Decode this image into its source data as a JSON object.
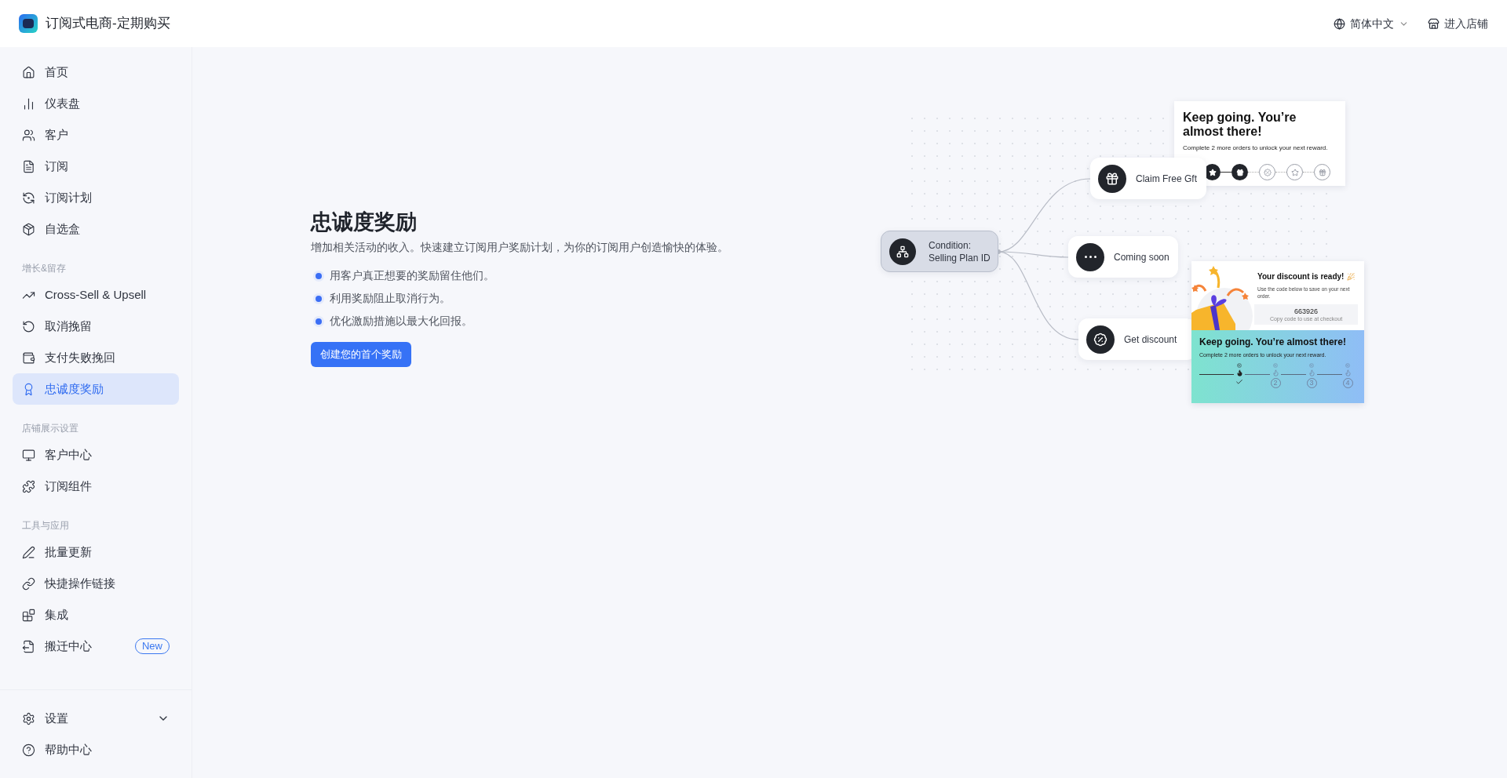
{
  "header": {
    "app_title": "订阅式电商-定期购买",
    "language": "简体中文",
    "store_link": "进入店铺"
  },
  "sidebar": {
    "sections": [
      {
        "items": [
          {
            "label": "首页",
            "selected": false
          },
          {
            "label": "仪表盘",
            "selected": false
          },
          {
            "label": "客户",
            "selected": false
          },
          {
            "label": "订阅",
            "selected": false
          },
          {
            "label": "订阅计划",
            "selected": false
          },
          {
            "label": "自选盒",
            "selected": false
          }
        ]
      },
      {
        "heading": "增长&留存",
        "items": [
          {
            "label": "Cross-Sell & Upsell",
            "selected": false
          },
          {
            "label": "取消挽留",
            "selected": false
          },
          {
            "label": "支付失败挽回",
            "selected": false
          },
          {
            "label": "忠诚度奖励",
            "selected": true
          }
        ]
      },
      {
        "heading": "店铺展示设置",
        "items": [
          {
            "label": "客户中心",
            "selected": false
          },
          {
            "label": "订阅组件",
            "selected": false
          }
        ]
      },
      {
        "heading": "工具与应用",
        "items": [
          {
            "label": "批量更新",
            "selected": false
          },
          {
            "label": "快捷操作链接",
            "selected": false
          },
          {
            "label": "集成",
            "selected": false
          },
          {
            "label": "搬迁中心",
            "selected": false,
            "badge": "New"
          }
        ]
      }
    ],
    "footer": [
      {
        "label": "设置",
        "expanded": false
      },
      {
        "label": "帮助中心"
      }
    ]
  },
  "main": {
    "title": "忠诚度奖励",
    "description": "增加相关活动的收入。快速建立订阅用户奖励计划，为你的订阅用户创造愉快的体验。",
    "bullets": [
      "用客户真正想要的奖励留住他们。",
      "利用奖励阻止取消行为。",
      "优化激励措施以最大化回报。"
    ],
    "button": "创建您的首个奖励"
  },
  "illustration": {
    "condition": [
      "Condition:",
      "Selling Plan ID"
    ],
    "rewards": [
      {
        "label": "Claim Free Gft"
      },
      {
        "label": "Coming soon"
      },
      {
        "label": "Get discount"
      }
    ],
    "progress_card": {
      "title": "Keep going. You’re almost there!",
      "text": "Complete 2 more orders to unlock your next reward.",
      "steps": [
        {
          "done": true
        },
        {
          "done": true
        },
        {
          "done": false
        },
        {
          "done": false
        },
        {
          "done": false
        }
      ]
    },
    "discount_card": {
      "title": "Your discount is ready!",
      "text": "Use the code below to save on your next order.",
      "code": "663926",
      "code_hint": "Copy code to use at checkout",
      "banner_title": "Keep going. You’re almost there!",
      "banner_text": "Complete 2 more orders to unlock your next reward.",
      "steps": [
        {
          "done": true
        },
        {
          "done": false,
          "number": "2"
        },
        {
          "done": false,
          "number": "3"
        },
        {
          "done": false,
          "number": "4"
        }
      ]
    }
  }
}
